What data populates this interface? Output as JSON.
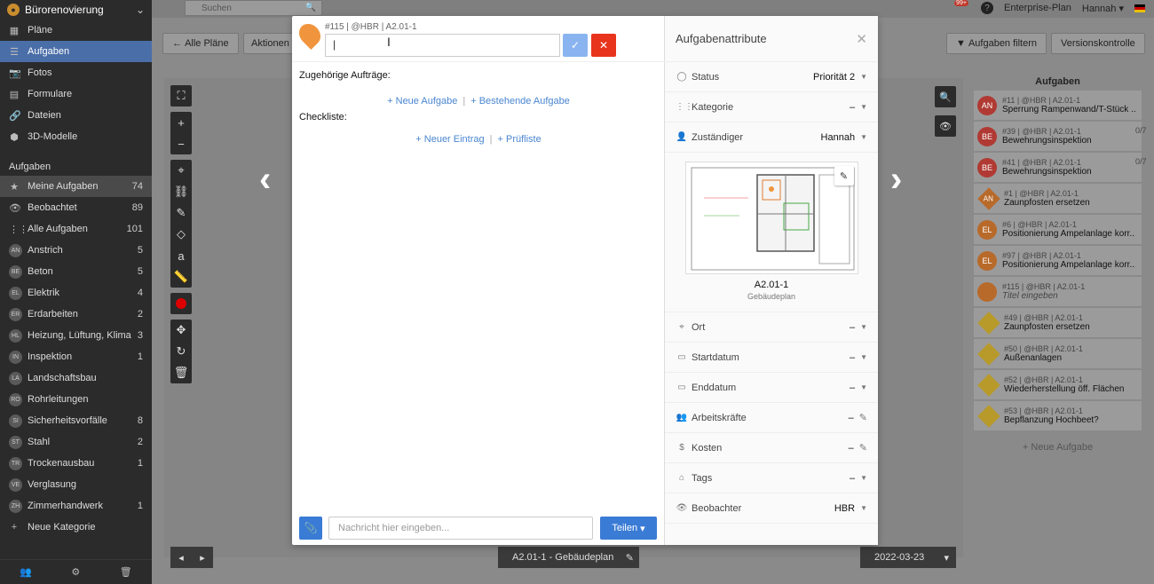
{
  "sidebar": {
    "project": "Bürorenovierung",
    "nav": [
      {
        "label": "Pläne",
        "icon": "map-icon"
      },
      {
        "label": "Aufgaben",
        "icon": "list-icon"
      },
      {
        "label": "Fotos",
        "icon": "camera-icon"
      },
      {
        "label": "Formulare",
        "icon": "form-icon"
      },
      {
        "label": "Dateien",
        "icon": "paperclip-icon"
      },
      {
        "label": "3D-Modelle",
        "icon": "cube-icon"
      }
    ],
    "section_title": "Aufgaben",
    "filters": [
      {
        "label": "Meine Aufgaben",
        "count": "74"
      },
      {
        "label": "Beobachtet",
        "count": "89"
      },
      {
        "label": "Alle Aufgaben",
        "count": "101"
      }
    ],
    "categories": [
      {
        "abbr": "AN",
        "label": "Anstrich",
        "count": "5"
      },
      {
        "abbr": "BE",
        "label": "Beton",
        "count": "5"
      },
      {
        "abbr": "EL",
        "label": "Elektrik",
        "count": "4"
      },
      {
        "abbr": "ER",
        "label": "Erdarbeiten",
        "count": "2"
      },
      {
        "abbr": "HL",
        "label": "Heizung, Lüftung, Klima",
        "count": "3"
      },
      {
        "abbr": "IN",
        "label": "Inspektion",
        "count": "1"
      },
      {
        "abbr": "LA",
        "label": "Landschaftsbau",
        "count": ""
      },
      {
        "abbr": "RO",
        "label": "Rohrleitungen",
        "count": ""
      },
      {
        "abbr": "SI",
        "label": "Sicherheitsvorfälle",
        "count": "8"
      },
      {
        "abbr": "ST",
        "label": "Stahl",
        "count": "2"
      },
      {
        "abbr": "TR",
        "label": "Trockenausbau",
        "count": "1"
      },
      {
        "abbr": "VE",
        "label": "Verglasung",
        "count": ""
      },
      {
        "abbr": "ZH",
        "label": "Zimmerhandwerk",
        "count": "1"
      }
    ],
    "new_category": "Neue Kategorie"
  },
  "topbar": {
    "search_placeholder": "Suchen",
    "notifications": "99+",
    "help": "?",
    "plan_label": "Enterprise-Plan",
    "user": "Hannah"
  },
  "toolbar": {
    "all_plans": "Alle Pläne",
    "actions": "Aktionen",
    "filter_tasks": "Aufgaben filtern",
    "version_control": "Versionskontrolle"
  },
  "bottombar": {
    "plan_name": "A2.01-1 - Gebäudeplan",
    "date": "2022-03-23"
  },
  "task_list": {
    "title": "Aufgaben",
    "items": [
      {
        "abbr": "AN",
        "meta": "#11 | @HBR | A2.01-1",
        "title": "Sperrung Rampenwand/T-Stück ...",
        "progress": "",
        "shape": "pin",
        "color": "#b03a33"
      },
      {
        "abbr": "BE",
        "meta": "#39 | @HBR | A2.01-1",
        "title": "Bewehrungsinspektion",
        "progress": "0/7",
        "shape": "pin",
        "color": "#b03a33"
      },
      {
        "abbr": "BE",
        "meta": "#41 | @HBR | A2.01-1",
        "title": "Bewehrungsinspektion",
        "progress": "0/7",
        "shape": "pin",
        "color": "#b03a33"
      },
      {
        "abbr": "AN",
        "meta": "#1 | @HBR | A2.01-1",
        "title": "Zaunpfosten ersetzen",
        "progress": "",
        "shape": "diamond",
        "color": "#b86a2a"
      },
      {
        "abbr": "EL",
        "meta": "#6 | @HBR | A2.01-1",
        "title": "Positionierung Ampelanlage korr...",
        "progress": "",
        "shape": "pin",
        "color": "#b86a2a"
      },
      {
        "abbr": "EL",
        "meta": "#97 | @HBR | A2.01-1",
        "title": "Positionierung Ampelanlage korr...",
        "progress": "",
        "shape": "pin",
        "color": "#b86a2a"
      },
      {
        "abbr": "",
        "meta": "#115 | @HBR | A2.01-1",
        "title": "Titel eingeben",
        "progress": "",
        "shape": "pin",
        "color": "#b86a2a",
        "italic": true
      },
      {
        "abbr": "",
        "meta": "#49 | @HBR | A2.01-1",
        "title": "Zaunpfosten ersetzen",
        "progress": "",
        "shape": "diamond",
        "color": "#b89a2a"
      },
      {
        "abbr": "",
        "meta": "#50 | @HBR | A2.01-1",
        "title": "Außenanlagen",
        "progress": "",
        "shape": "diamond",
        "color": "#b89a2a"
      },
      {
        "abbr": "",
        "meta": "#52 | @HBR | A2.01-1",
        "title": "Wiederherstellung öff. Flächen",
        "progress": "",
        "shape": "diamond",
        "color": "#b89a2a"
      },
      {
        "abbr": "",
        "meta": "#53 | @HBR | A2.01-1",
        "title": "Bepflanzung Hochbeet?",
        "progress": "",
        "shape": "diamond",
        "color": "#b89a2a"
      }
    ],
    "new_task": "+ Neue Aufgabe"
  },
  "modal": {
    "meta": "#115 | @HBR | A2.01-1",
    "title_value": "|",
    "related_label": "Zugehörige Aufträge:",
    "new_task_link": "+ Neue Aufgabe",
    "existing_task_link": "+ Bestehende Aufgabe",
    "checklist_label": "Checkliste:",
    "new_entry_link": "+ Neuer Eintrag",
    "checklist_link": "+ Prüfliste",
    "message_placeholder": "Nachricht hier eingeben...",
    "share_label": "Teilen",
    "attributes_title": "Aufgabenattribute",
    "attributes_top": [
      {
        "icon": "status-icon",
        "label": "Status",
        "value": "Priorität 2",
        "edit": "caret"
      },
      {
        "icon": "grid-icon",
        "label": "Kategorie",
        "value": "–",
        "edit": "caret"
      },
      {
        "icon": "user-icon",
        "label": "Zuständiger",
        "value": "Hannah",
        "edit": "caret"
      }
    ],
    "plan_thumb_name": "A2.01-1",
    "plan_thumb_sub": "Gebäudeplan",
    "attributes_bottom": [
      {
        "icon": "location-icon",
        "label": "Ort",
        "value": "–",
        "edit": "caret"
      },
      {
        "icon": "calendar-icon",
        "label": "Startdatum",
        "value": "–",
        "edit": "caret"
      },
      {
        "icon": "calendar-icon",
        "label": "Enddatum",
        "value": "–",
        "edit": "caret"
      },
      {
        "icon": "workers-icon",
        "label": "Arbeitskräfte",
        "value": "–",
        "edit": "pencil"
      },
      {
        "icon": "money-icon",
        "label": "Kosten",
        "value": "–",
        "edit": "pencil"
      },
      {
        "icon": "tag-icon",
        "label": "Tags",
        "value": "–",
        "edit": "caret"
      },
      {
        "icon": "eye-icon",
        "label": "Beobachter",
        "value": "HBR",
        "edit": "caret"
      }
    ]
  },
  "colors": {
    "accent": "#3a7bd5",
    "sidebar_bg": "#2b2b2b",
    "pin_orange": "#f0953e",
    "cancel_red": "#e8341c"
  }
}
